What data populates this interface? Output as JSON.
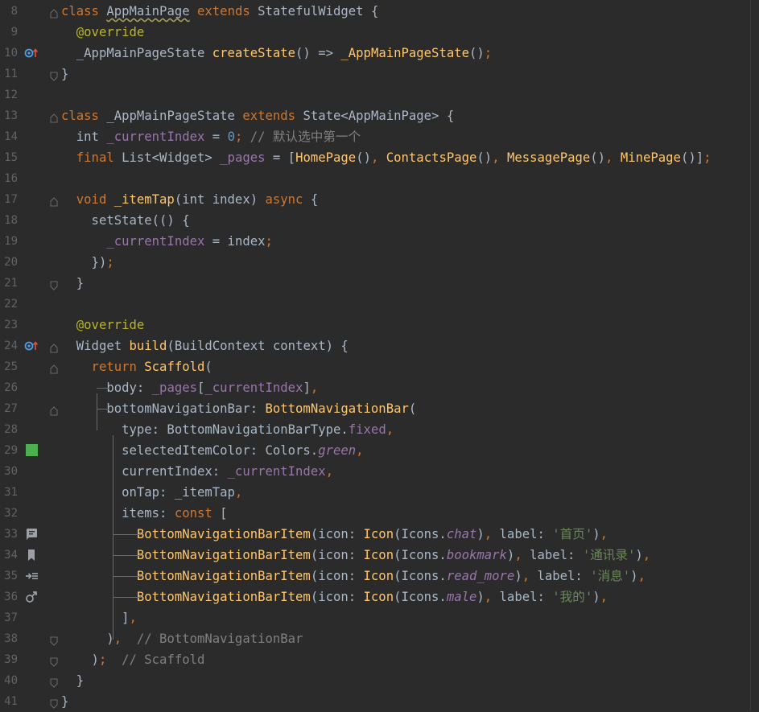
{
  "editor": {
    "lines": [
      {
        "n": "8",
        "tokens": [
          [
            "kw",
            "class "
          ],
          [
            "cls squiggle",
            "AppMainPage"
          ],
          [
            "kw",
            " extends "
          ],
          [
            "cls",
            "StatefulWidget {"
          ]
        ]
      },
      {
        "n": "9",
        "tokens": [
          [
            "ann",
            "  @override"
          ]
        ]
      },
      {
        "n": "10",
        "tokens": [
          [
            "cls",
            "  _AppMainPageState "
          ],
          [
            "fn",
            "createState"
          ],
          [
            "cls",
            "() => "
          ],
          [
            "fn",
            "_AppMainPageState"
          ],
          [
            "cls",
            "()"
          ],
          [
            "kw",
            ";"
          ]
        ]
      },
      {
        "n": "11",
        "tokens": [
          [
            "cls",
            "}"
          ]
        ]
      },
      {
        "n": "12",
        "tokens": []
      },
      {
        "n": "13",
        "tokens": [
          [
            "kw",
            "class "
          ],
          [
            "cls",
            "_AppMainPageState "
          ],
          [
            "kw",
            "extends "
          ],
          [
            "cls",
            "State<AppMainPage> {"
          ]
        ]
      },
      {
        "n": "14",
        "tokens": [
          [
            "cls",
            "  int "
          ],
          [
            "field",
            "_currentIndex"
          ],
          [
            "cls",
            " = "
          ],
          [
            "num",
            "0"
          ],
          [
            "kw",
            ";"
          ],
          [
            "cmt",
            " // 默认选中第一个"
          ]
        ]
      },
      {
        "n": "15",
        "tokens": [
          [
            "kw",
            "  final "
          ],
          [
            "cls",
            "List<Widget> "
          ],
          [
            "field",
            "_pages"
          ],
          [
            "cls",
            " = ["
          ],
          [
            "fn",
            "HomePage"
          ],
          [
            "cls",
            "()"
          ],
          [
            "kw",
            ", "
          ],
          [
            "fn",
            "ContactsPage"
          ],
          [
            "cls",
            "()"
          ],
          [
            "kw",
            ", "
          ],
          [
            "fn",
            "MessagePage"
          ],
          [
            "cls",
            "()"
          ],
          [
            "kw",
            ", "
          ],
          [
            "fn",
            "MinePage"
          ],
          [
            "cls",
            "()]"
          ],
          [
            "kw",
            ";"
          ]
        ]
      },
      {
        "n": "16",
        "tokens": []
      },
      {
        "n": "17",
        "tokens": [
          [
            "kw",
            "  void "
          ],
          [
            "fn",
            "_itemTap"
          ],
          [
            "cls",
            "(int index) "
          ],
          [
            "kw",
            "async "
          ],
          [
            "cls",
            "{"
          ]
        ]
      },
      {
        "n": "18",
        "tokens": [
          [
            "cls",
            "    setState(() {"
          ]
        ]
      },
      {
        "n": "19",
        "tokens": [
          [
            "field",
            "      _currentIndex"
          ],
          [
            "cls",
            " = index"
          ],
          [
            "kw",
            ";"
          ]
        ]
      },
      {
        "n": "20",
        "tokens": [
          [
            "cls",
            "    })"
          ],
          [
            "kw",
            ";"
          ]
        ]
      },
      {
        "n": "21",
        "tokens": [
          [
            "cls",
            "  }"
          ]
        ]
      },
      {
        "n": "22",
        "tokens": []
      },
      {
        "n": "23",
        "tokens": [
          [
            "ann",
            "  @override"
          ]
        ]
      },
      {
        "n": "24",
        "tokens": [
          [
            "cls",
            "  Widget "
          ],
          [
            "fn",
            "build"
          ],
          [
            "cls",
            "(BuildContext context) {"
          ]
        ]
      },
      {
        "n": "25",
        "tokens": [
          [
            "kw",
            "    return "
          ],
          [
            "fn",
            "Scaffold"
          ],
          [
            "cls",
            "("
          ]
        ]
      },
      {
        "n": "26",
        "tokens": [
          [
            "cls",
            "      body: "
          ],
          [
            "field",
            "_pages"
          ],
          [
            "cls",
            "["
          ],
          [
            "field",
            "_currentIndex"
          ],
          [
            "cls",
            "]"
          ],
          [
            "kw",
            ","
          ]
        ]
      },
      {
        "n": "27",
        "tokens": [
          [
            "cls",
            "      bottomNavigationBar: "
          ],
          [
            "fn",
            "BottomNavigationBar"
          ],
          [
            "cls",
            "("
          ]
        ]
      },
      {
        "n": "28",
        "tokens": [
          [
            "cls",
            "        type: BottomNavigationBarType."
          ],
          [
            "field",
            "fixed"
          ],
          [
            "kw",
            ","
          ]
        ]
      },
      {
        "n": "29",
        "tokens": [
          [
            "cls",
            "        selectedItemColor: Colors."
          ],
          [
            "ital",
            "green"
          ],
          [
            "kw",
            ","
          ]
        ]
      },
      {
        "n": "30",
        "tokens": [
          [
            "cls",
            "        currentIndex: "
          ],
          [
            "field",
            "_currentIndex"
          ],
          [
            "kw",
            ","
          ]
        ]
      },
      {
        "n": "31",
        "tokens": [
          [
            "cls",
            "        onTap: _itemTap"
          ],
          [
            "kw",
            ","
          ]
        ]
      },
      {
        "n": "32",
        "tokens": [
          [
            "cls",
            "        items: "
          ],
          [
            "kw",
            "const "
          ],
          [
            "cls",
            "["
          ]
        ]
      },
      {
        "n": "33",
        "tokens": [
          [
            "fn",
            "          BottomNavigationBarItem"
          ],
          [
            "cls",
            "(icon: "
          ],
          [
            "fn",
            "Icon"
          ],
          [
            "cls",
            "(Icons."
          ],
          [
            "ital",
            "chat"
          ],
          [
            "cls",
            ")"
          ],
          [
            "kw",
            ", "
          ],
          [
            "cls",
            "label: "
          ],
          [
            "str",
            "'首页'"
          ],
          [
            "cls",
            ")"
          ],
          [
            "kw",
            ","
          ]
        ]
      },
      {
        "n": "34",
        "tokens": [
          [
            "fn",
            "          BottomNavigationBarItem"
          ],
          [
            "cls",
            "(icon: "
          ],
          [
            "fn",
            "Icon"
          ],
          [
            "cls",
            "(Icons."
          ],
          [
            "ital",
            "bookmark"
          ],
          [
            "cls",
            ")"
          ],
          [
            "kw",
            ", "
          ],
          [
            "cls",
            "label: "
          ],
          [
            "str",
            "'通讯录'"
          ],
          [
            "cls",
            ")"
          ],
          [
            "kw",
            ","
          ]
        ]
      },
      {
        "n": "35",
        "tokens": [
          [
            "fn",
            "          BottomNavigationBarItem"
          ],
          [
            "cls",
            "(icon: "
          ],
          [
            "fn",
            "Icon"
          ],
          [
            "cls",
            "(Icons."
          ],
          [
            "ital",
            "read_more"
          ],
          [
            "cls",
            ")"
          ],
          [
            "kw",
            ", "
          ],
          [
            "cls",
            "label: "
          ],
          [
            "str",
            "'消息'"
          ],
          [
            "cls",
            ")"
          ],
          [
            "kw",
            ","
          ]
        ]
      },
      {
        "n": "36",
        "tokens": [
          [
            "fn",
            "          BottomNavigationBarItem"
          ],
          [
            "cls",
            "(icon: "
          ],
          [
            "fn",
            "Icon"
          ],
          [
            "cls",
            "(Icons."
          ],
          [
            "ital",
            "male"
          ],
          [
            "cls",
            ")"
          ],
          [
            "kw",
            ", "
          ],
          [
            "cls",
            "label: "
          ],
          [
            "str",
            "'我的'"
          ],
          [
            "cls",
            ")"
          ],
          [
            "kw",
            ","
          ]
        ]
      },
      {
        "n": "37",
        "tokens": [
          [
            "cls",
            "        ]"
          ],
          [
            "kw",
            ","
          ]
        ]
      },
      {
        "n": "38",
        "tokens": [
          [
            "cls",
            "      )"
          ],
          [
            "kw",
            ","
          ],
          [
            "cmt",
            "  // BottomNavigationBar"
          ]
        ]
      },
      {
        "n": "39",
        "tokens": [
          [
            "cls",
            "    )"
          ],
          [
            "kw",
            ";"
          ],
          [
            "cmt",
            "  // Scaffold"
          ]
        ]
      },
      {
        "n": "40",
        "tokens": [
          [
            "cls",
            "  }"
          ]
        ]
      },
      {
        "n": "41",
        "tokens": [
          [
            "cls",
            "}"
          ]
        ]
      }
    ],
    "gutter_icons": {
      "10": "override-method-icon",
      "24": "override-method-icon",
      "29": "color-swatch-icon",
      "33": "chat-icon",
      "34": "bookmark-icon",
      "35": "read-more-icon",
      "36": "male-icon"
    },
    "swatch_color": "#4caf50",
    "fold_lines": [
      "8",
      "11",
      "13",
      "17",
      "21",
      "24",
      "25",
      "27",
      "38",
      "39",
      "40",
      "41"
    ]
  }
}
